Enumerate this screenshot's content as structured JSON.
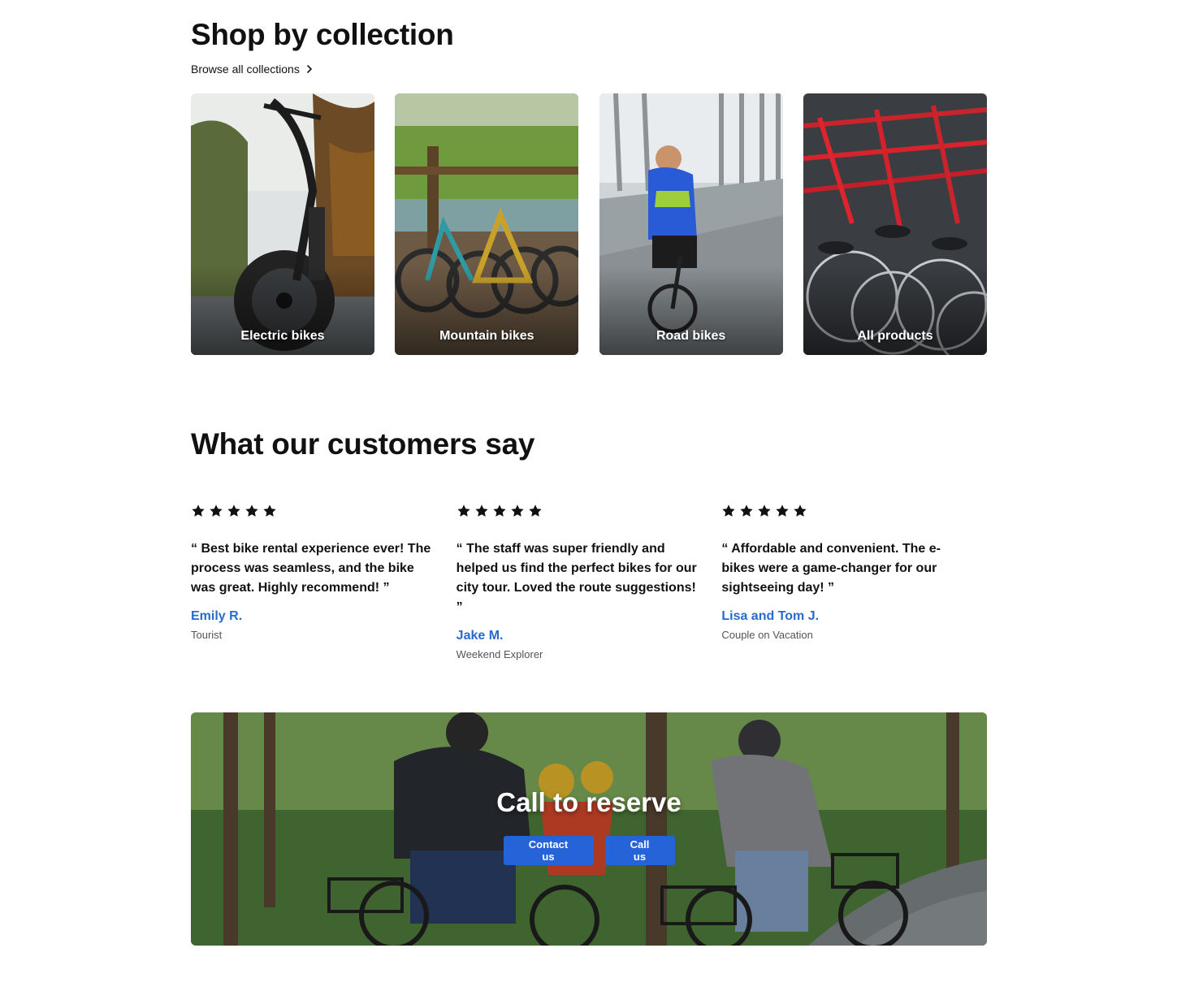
{
  "collections": {
    "title": "Shop by collection",
    "browse_label": "Browse all collections",
    "items": [
      {
        "label": "Electric bikes"
      },
      {
        "label": "Mountain bikes"
      },
      {
        "label": "Road bikes"
      },
      {
        "label": "All products"
      }
    ]
  },
  "testimonials": {
    "title": "What our customers say",
    "rating_max": 5,
    "items": [
      {
        "rating": 5,
        "quote": "“ Best bike rental experience ever! The process was seamless, and the bike was great. Highly recommend! ”",
        "author": "Emily R.",
        "role": "Tourist"
      },
      {
        "rating": 5,
        "quote": "“ The staff was super friendly and helped us find the perfect bikes for our city tour. Loved the route suggestions! ”",
        "author": "Jake M.",
        "role": "Weekend Explorer"
      },
      {
        "rating": 5,
        "quote": "“ Affordable and convenient. The e-bikes were a game-changer for our sightseeing day! ”",
        "author": "Lisa and Tom J.",
        "role": "Couple on Vacation"
      }
    ]
  },
  "banner": {
    "title": "Call to reserve",
    "buttons": {
      "contact": "Contact us",
      "call": "Call us"
    }
  },
  "colors": {
    "accent": "#2563d9",
    "author_link": "#2a6acb"
  }
}
